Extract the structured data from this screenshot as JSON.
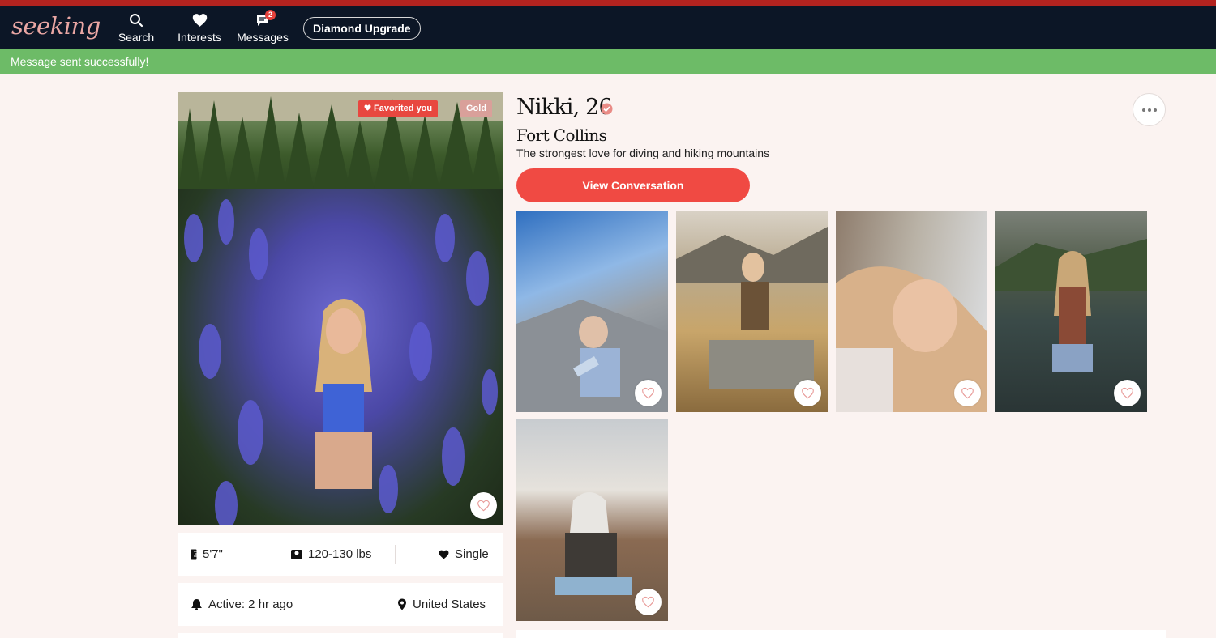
{
  "brand": {
    "logo_text": "seeking",
    "accent": "#e5413b",
    "nav_bg": "#0c1626",
    "toast_bg": "#6dbb67"
  },
  "nav": {
    "items": [
      {
        "label": "Search",
        "icon": "search-icon"
      },
      {
        "label": "Interests",
        "icon": "heart-icon"
      },
      {
        "label": "Messages",
        "icon": "chat-icon",
        "badge": "2"
      }
    ],
    "upgrade_label": "Diamond Upgrade"
  },
  "toast": {
    "text": "Message sent successfully!"
  },
  "profile": {
    "name_age": "Nikki, 26",
    "city": "Fort Collins",
    "tagline": "The strongest love for diving and hiking mountains",
    "view_conversation_label": "View Conversation",
    "favorited_badge": "Favorited you",
    "tier_badge": "Gold",
    "height": "5'7\"",
    "weight": "120-130 lbs",
    "relationship": "Single",
    "active": "Active: 2 hr ago",
    "location": "United States"
  },
  "gallery": {
    "photos": [
      {
        "label": "photo-1"
      },
      {
        "label": "photo-2"
      },
      {
        "label": "photo-3"
      },
      {
        "label": "photo-4"
      },
      {
        "label": "photo-5"
      }
    ]
  }
}
